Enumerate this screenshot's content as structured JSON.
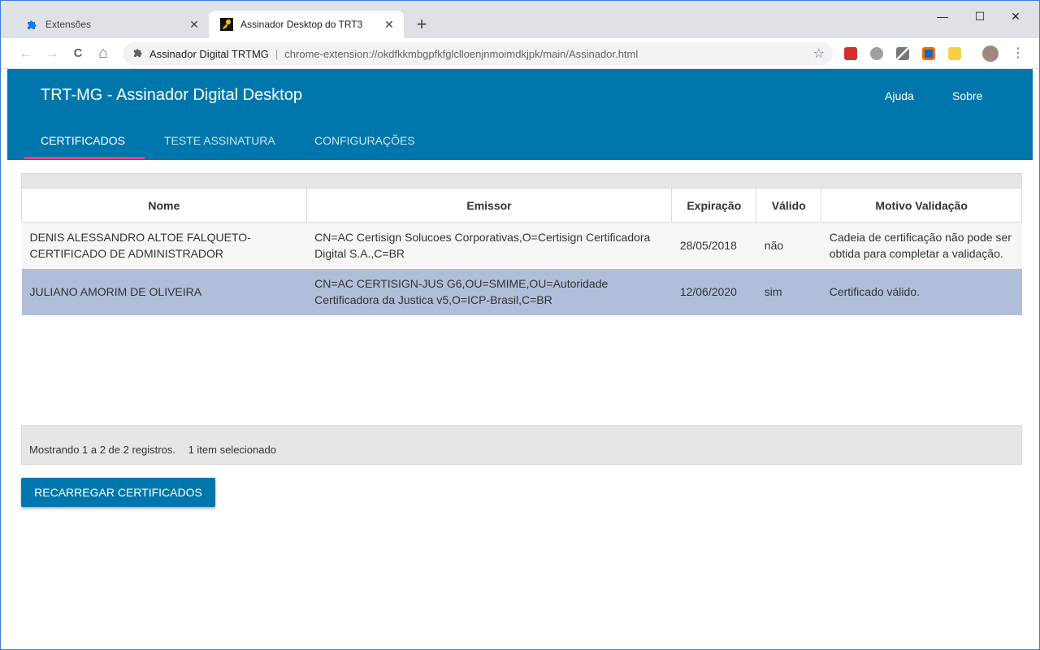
{
  "browser": {
    "tabs": [
      {
        "title": "Extensões",
        "icon": "puzzle-icon"
      },
      {
        "title": "Assinador Desktop do TRT3",
        "icon": "key-icon",
        "active": true
      }
    ],
    "new_tab": "+",
    "window_controls": {
      "minimize": "—",
      "maximize": "☐",
      "close": "✕"
    },
    "omnibox": {
      "site_name": "Assinador Digital TRTMG",
      "separator": "|",
      "url": "chrome-extension://okdfkkmbgpfkfglclloenjnmoimdkjpk/main/Assinador.html"
    },
    "nav": {
      "back": "←",
      "forward": "→",
      "reload": "C",
      "home": "⌂"
    }
  },
  "app": {
    "title": "TRT-MG - Assinador Digital Desktop",
    "links": {
      "help": "Ajuda",
      "about": "Sobre"
    },
    "tabs": [
      {
        "label": "CERTIFICADOS",
        "active": true
      },
      {
        "label": "TESTE ASSINATURA"
      },
      {
        "label": "CONFIGURAÇÕES"
      }
    ],
    "accent_color": "#0077ac",
    "tab_indicator_color": "#ff4081"
  },
  "table": {
    "headers": [
      "Nome",
      "Emissor",
      "Expiração",
      "Válido",
      "Motivo Validação"
    ],
    "rows": [
      {
        "nome": "DENIS ALESSANDRO ALTOE FALQUETO-CERTIFICADO DE ADMINISTRADOR",
        "emissor": "CN=AC Certisign Solucoes Corporativas,O=Certisign Certificadora Digital S.A.,C=BR",
        "expiracao": "28/05/2018",
        "valido": "não",
        "motivo": "Cadeia de certificação não pode ser obtida para completar a validação."
      },
      {
        "nome": "JULIANO AMORIM DE OLIVEIRA",
        "emissor": "CN=AC CERTISIGN-JUS G6,OU=SMIME,OU=Autoridade Certificadora da Justica v5,O=ICP-Brasil,C=BR",
        "expiracao": "12/06/2020",
        "valido": "sim",
        "motivo": "Certificado válido.",
        "selected": true
      }
    ]
  },
  "status": {
    "showing": "Mostrando 1 a 2 de 2 registros.",
    "selected": "1 item selecionado"
  },
  "actions": {
    "reload_label": "RECARREGAR CERTIFICADOS"
  }
}
